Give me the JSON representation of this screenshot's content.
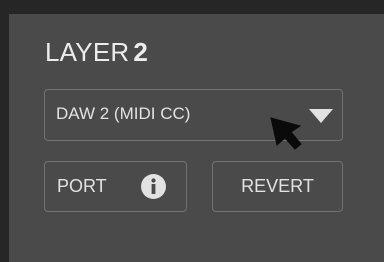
{
  "layer": {
    "label": "LAYER",
    "number": "2"
  },
  "dropdown": {
    "value": "DAW 2 (MIDI CC)",
    "icon": "chevron-down-icon"
  },
  "buttons": {
    "port_label": "PORT",
    "port_icon": "info-icon",
    "revert_label": "REVERT"
  },
  "colors": {
    "panel": "#4a4a4a",
    "background": "#262626",
    "text": "#e2e2e2",
    "border": "#727272"
  }
}
